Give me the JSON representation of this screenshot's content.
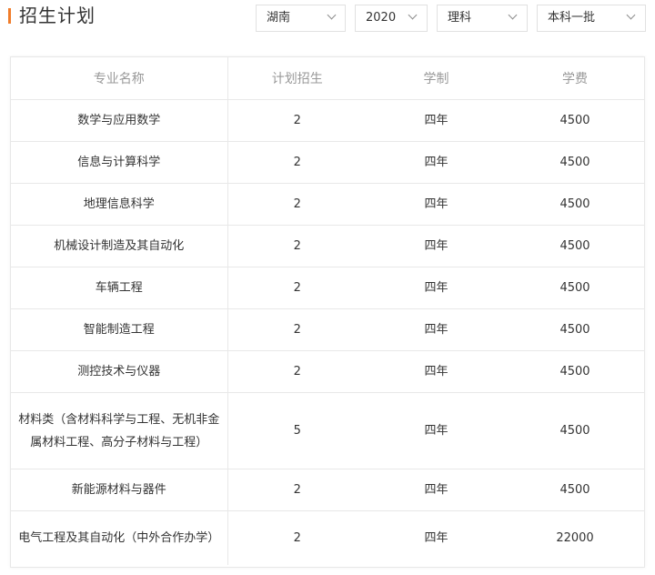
{
  "header": {
    "title": "招生计划"
  },
  "filters": {
    "province": "湖南",
    "year": "2020",
    "subject": "理科",
    "batch": "本科一批"
  },
  "table": {
    "columns": [
      "专业名称",
      "计划招生",
      "学制",
      "学费"
    ],
    "rows": [
      {
        "major": "数学与应用数学",
        "plan": "2",
        "duration": "四年",
        "fee": "4500"
      },
      {
        "major": "信息与计算科学",
        "plan": "2",
        "duration": "四年",
        "fee": "4500"
      },
      {
        "major": "地理信息科学",
        "plan": "2",
        "duration": "四年",
        "fee": "4500"
      },
      {
        "major": "机械设计制造及其自动化",
        "plan": "2",
        "duration": "四年",
        "fee": "4500"
      },
      {
        "major": "车辆工程",
        "plan": "2",
        "duration": "四年",
        "fee": "4500"
      },
      {
        "major": "智能制造工程",
        "plan": "2",
        "duration": "四年",
        "fee": "4500"
      },
      {
        "major": "测控技术与仪器",
        "plan": "2",
        "duration": "四年",
        "fee": "4500"
      },
      {
        "major": "材料类（含材料科学与工程、无机非金属材料工程、高分子材料与工程）",
        "plan": "5",
        "duration": "四年",
        "fee": "4500"
      },
      {
        "major": "新能源材料与器件",
        "plan": "2",
        "duration": "四年",
        "fee": "4500"
      },
      {
        "major": "电气工程及其自动化（中外合作办学）",
        "plan": "2",
        "duration": "四年",
        "fee": "22000"
      }
    ]
  }
}
